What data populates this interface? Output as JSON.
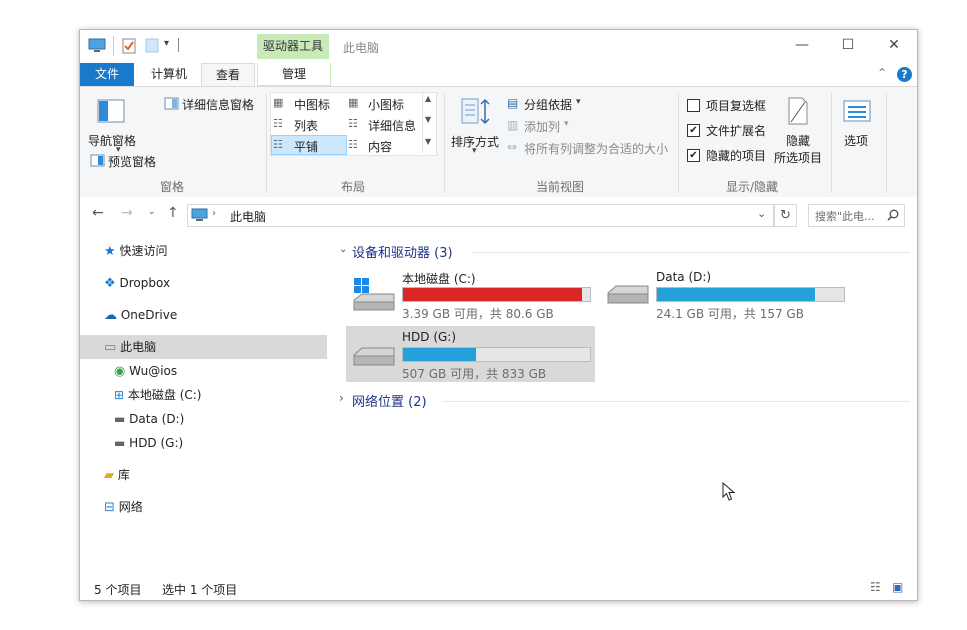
{
  "window": {
    "context_tab": "驱动器工具",
    "title": "此电脑",
    "controls": {
      "minimize": "—",
      "maximize": "☐",
      "close": "✕"
    }
  },
  "tabs": {
    "file": "文件",
    "computer": "计算机",
    "view": "查看",
    "manage": "管理"
  },
  "ribbon": {
    "panes": {
      "nav_pane": "导航窗格",
      "preview_pane": "预览窗格",
      "details_pane": "详细信息窗格",
      "label": "窗格"
    },
    "layout": {
      "medium_icons": "中图标",
      "small_icons": "小图标",
      "list": "列表",
      "details": "详细信息",
      "tiles": "平铺",
      "content": "内容",
      "label": "布局"
    },
    "current_view": {
      "sort_by": "排序方式",
      "group_by": "分组依据",
      "add_columns": "添加列",
      "size_all_columns": "将所有列调整为合适的大小",
      "label": "当前视图"
    },
    "show_hide": {
      "item_checkboxes": "项目复选框",
      "file_extensions": "文件扩展名",
      "hidden_items": "隐藏的项目",
      "hide_selected_1": "隐藏",
      "hide_selected_2": "所选项目",
      "label": "显示/隐藏",
      "checks": {
        "item_checkboxes": false,
        "file_extensions": true,
        "hidden_items": true
      }
    },
    "options": "选项"
  },
  "address": {
    "path": "此电脑",
    "search_placeholder": "搜索\"此电..."
  },
  "nav": {
    "quick_access": "快速访问",
    "dropbox": "Dropbox",
    "onedrive": "OneDrive",
    "this_pc": "此电脑",
    "wu_ios": "Wu@ios",
    "local_c": "本地磁盘 (C:)",
    "data_d": "Data (D:)",
    "hdd_g": "HDD (G:)",
    "library": "库",
    "network": "网络"
  },
  "main": {
    "devices_header": "设备和驱动器 (3)",
    "network_header": "网络位置 (2)",
    "drives": [
      {
        "name": "本地磁盘 (C:)",
        "info": "3.39 GB 可用，共 80.6 GB",
        "used_fraction": 0.958,
        "bar_color": "#da2626"
      },
      {
        "name": "Data (D:)",
        "info": "24.1 GB 可用，共 157 GB",
        "used_fraction": 0.846,
        "bar_color": "#26a0da"
      },
      {
        "name": "HDD (G:)",
        "info": "507 GB 可用，共 833 GB",
        "used_fraction": 0.391,
        "bar_color": "#26a0da"
      }
    ]
  },
  "status": {
    "item_count": "5 个项目",
    "selected": "选中 1 个项目"
  }
}
